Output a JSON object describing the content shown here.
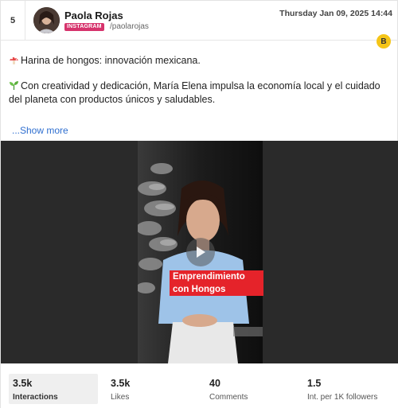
{
  "post": {
    "rank": "5",
    "author_name": "Paola Rojas",
    "platform": "INSTAGRAM",
    "handle": "/paolarojas",
    "date": "Thursday Jan 09, 2025 14:44",
    "badge": "B"
  },
  "caption": {
    "line1_icon": "mushroom-icon",
    "line1": "Harina de hongos: innovación mexicana.",
    "line2_icon": "seedling-icon",
    "line2": "Con creatividad y dedicación, María Elena impulsa la economía local y el cuidado del planeta con productos únicos y saludables.",
    "show_more": "...Show more"
  },
  "media": {
    "title_line1": "Emprendimiento",
    "title_line2": "con Hongos",
    "play_icon": "play-icon"
  },
  "stats": [
    {
      "value": "3.5k",
      "label": "Interactions"
    },
    {
      "value": "3.5k",
      "label": "Likes"
    },
    {
      "value": "40",
      "label": "Comments"
    },
    {
      "value": "1.5",
      "label": "Int. per 1K followers"
    }
  ],
  "colors": {
    "platform_badge": "#d6336c",
    "link": "#2f6fd0",
    "b_badge": "#f5c518",
    "video_banner": "#e5232a"
  }
}
